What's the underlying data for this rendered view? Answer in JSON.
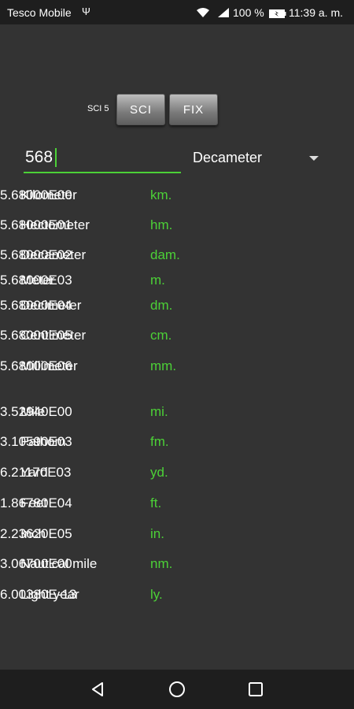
{
  "status_bar": {
    "carrier": "Tesco Mobile",
    "usb_icon": "usb-icon",
    "battery_pct": "100 %",
    "time": "11:39 a. m."
  },
  "mode": {
    "label": "SCI 5",
    "sci_label": "SCI",
    "fix_label": "FIX"
  },
  "input": {
    "value": "568"
  },
  "unit_select": {
    "selected": "Decameter"
  },
  "conversions": [
    {
      "name": "Kilometer",
      "abbr": "km.",
      "value": "5.68000E00"
    },
    {
      "name": "Hectometer",
      "abbr": "hm.",
      "value": "5.68000E01"
    },
    {
      "name": "Decameter",
      "abbr": "dam.",
      "value": "5.68000E02"
    },
    {
      "name": "Meter",
      "abbr": "m.",
      "value": "5.68000E03"
    },
    {
      "name": "Decimeter",
      "abbr": "dm.",
      "value": "5.68000E04"
    },
    {
      "name": "Centimeter",
      "abbr": "cm.",
      "value": "5.68000E05"
    },
    {
      "name": "Millimeter",
      "abbr": "mm.",
      "value": "5.68000E06"
    },
    {
      "name": "Mile",
      "abbr": "mi.",
      "value": "3.52940E00"
    },
    {
      "name": "Fathom",
      "abbr": "fm.",
      "value": "3.10590E03"
    },
    {
      "name": "Yard",
      "abbr": "yd.",
      "value": "6.21170E03"
    },
    {
      "name": "Feet",
      "abbr": "ft.",
      "value": "1.86780E04"
    },
    {
      "name": "Inch",
      "abbr": "in.",
      "value": "2.23620E05"
    },
    {
      "name": "Nautical mile",
      "abbr": "nm.",
      "value": "3.06700E00"
    },
    {
      "name": "Light year",
      "abbr": "ly.",
      "value": "6.00380E-13"
    }
  ],
  "colors": {
    "accent": "#4cd137",
    "background": "#333333",
    "bar": "#1e1e1e"
  }
}
